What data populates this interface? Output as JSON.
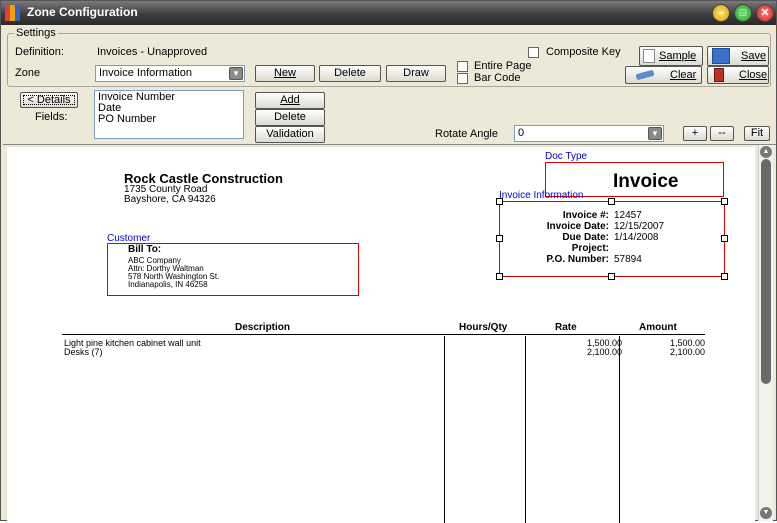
{
  "window": {
    "title": "Zone Configuration",
    "min": "–",
    "max": "□",
    "close": "✕"
  },
  "settings": {
    "group_label": "Settings",
    "definition_label": "Definition:",
    "definition_value": "Invoices - Unapproved",
    "composite_key": "Composite Key",
    "zone_label": "Zone",
    "zone_value": "Invoice Information",
    "new": "New",
    "delete": "Delete",
    "draw": "Draw",
    "entire_page": "Entire Page",
    "bar_code": "Bar Code",
    "sample": "Sample",
    "save": "Save",
    "clear": "Clear",
    "close": "Close"
  },
  "fields_panel": {
    "details": "< Details",
    "fields_label": "Fields:",
    "fields": [
      "Invoice Number",
      "Date",
      "PO Number"
    ],
    "add": "Add",
    "delete": "Delete",
    "validation": "Validation",
    "rotate_label": "Rotate Angle",
    "rotate_value": "0",
    "plus": "+",
    "minus": "--",
    "fit": "Fit"
  },
  "document": {
    "company_name": "Rock Castle Construction",
    "address1": "1735 County Road",
    "address2": "Bayshore, CA 94326",
    "heading": "Invoice",
    "bill_to_label": "Bill To:",
    "bill_to": [
      "ABC Company",
      "Attn: Dorthy Waltman",
      "578 North Washington St.",
      "Indianapolis, IN 46258"
    ],
    "info_labels": [
      "Invoice #:",
      "Invoice Date:",
      "Due Date:",
      "Project:",
      "P.O. Number:"
    ],
    "info_values": [
      "12457",
      "12/15/2007",
      "1/14/2008",
      "",
      "57894"
    ],
    "columns": {
      "description": "Description",
      "hours": "Hours/Qty",
      "rate": "Rate",
      "amount": "Amount"
    },
    "rows": [
      {
        "description": "Light pine kitchen cabinet wall unit",
        "rate": "1,500.00",
        "amount": "1,500.00"
      },
      {
        "description": "Desks (7)",
        "rate": "2,100.00",
        "amount": "2,100.00"
      }
    ]
  },
  "zones": {
    "doc_type": "Doc Type",
    "invoice_info": "Invoice Information",
    "customer": "Customer"
  },
  "icons": [
    "app-icon",
    "minimize-icon",
    "maximize-icon",
    "close-icon",
    "sample-icon",
    "save-icon",
    "clear-icon",
    "close-door-icon",
    "dropdown-arrow-icon",
    "scroll-up-icon",
    "scroll-down-icon"
  ],
  "colors": {
    "title_bar": "#3e3e3e",
    "zone_border": "#dd0000",
    "zone_label": "#0000dd",
    "minimize": "#f0c000",
    "maximize": "#30b030",
    "close": "#e03030"
  }
}
